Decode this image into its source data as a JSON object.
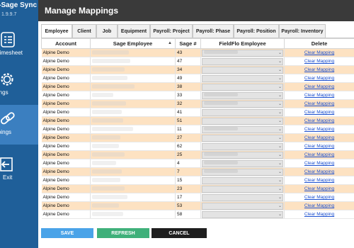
{
  "app": {
    "title": "F-Sage Sync",
    "version": "1.9.9.7"
  },
  "sidebar": {
    "items": [
      {
        "label": "rt Timesheet",
        "icon": "checklist-icon"
      },
      {
        "label": "ettings",
        "icon": "gear-icon"
      },
      {
        "label": "appings",
        "icon": "link-icon"
      },
      {
        "label": "Exit",
        "icon": "exit-icon"
      }
    ]
  },
  "header": {
    "title": "Manage Mappings"
  },
  "tabs": [
    "Employee",
    "Client",
    "Job",
    "Equipment",
    "Payroll: Project",
    "Payroll: Phase",
    "Payroll: Position",
    "Payroll: Inventory"
  ],
  "grid": {
    "columns": [
      "Account",
      "Sage Employee",
      "Sage #",
      "FieldFlo Employee",
      "Delete"
    ],
    "link_label": "Clear Mapping",
    "rows": [
      {
        "account": "Alpine Demo",
        "sage_no": "43"
      },
      {
        "account": "Alpine Demo",
        "sage_no": "47"
      },
      {
        "account": "Alpine Demo",
        "sage_no": "34"
      },
      {
        "account": "Alpine Demo",
        "sage_no": "49"
      },
      {
        "account": "Alpine Demo",
        "sage_no": "38"
      },
      {
        "account": "Alpine Demo",
        "sage_no": "33"
      },
      {
        "account": "Alpine Demo",
        "sage_no": "32"
      },
      {
        "account": "Alpine Demo",
        "sage_no": "41"
      },
      {
        "account": "Alpine Demo",
        "sage_no": "51"
      },
      {
        "account": "Alpine Demo",
        "sage_no": "11"
      },
      {
        "account": "Alpine Demo",
        "sage_no": "27"
      },
      {
        "account": "Alpine Demo",
        "sage_no": "62"
      },
      {
        "account": "Alpine Demo",
        "sage_no": "25"
      },
      {
        "account": "Alpine Demo",
        "sage_no": "4"
      },
      {
        "account": "Alpine Demo",
        "sage_no": "7"
      },
      {
        "account": "Alpine Demo",
        "sage_no": "15"
      },
      {
        "account": "Alpine Demo",
        "sage_no": "23"
      },
      {
        "account": "Alpine Demo",
        "sage_no": "17"
      },
      {
        "account": "Alpine Demo",
        "sage_no": "53"
      },
      {
        "account": "Alpine Demo",
        "sage_no": "58"
      }
    ]
  },
  "buttons": {
    "save": "SAVE",
    "refresh": "REFRESH",
    "cancel": "CANCEL"
  },
  "colors": {
    "sidebar": "#1f5f99",
    "header": "#3a3a3a",
    "row_alt": "#fde2c2",
    "link": "#1a4fd0"
  }
}
